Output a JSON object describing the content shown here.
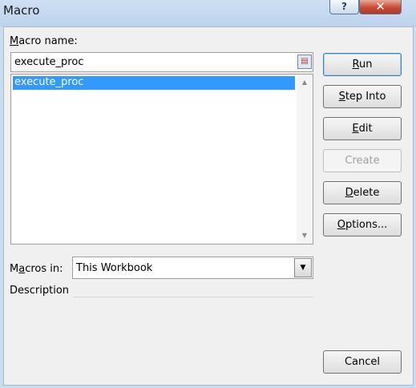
{
  "window": {
    "title": "Macro",
    "help_label": "?",
    "close_label": "✕"
  },
  "macro_name": {
    "label_prefix": "M",
    "label_rest": "acro name:",
    "value": "execute_proc"
  },
  "macro_list": {
    "items": [
      "execute_proc"
    ],
    "selected_index": 0
  },
  "buttons": {
    "run": {
      "u": "R",
      "rest": "un"
    },
    "step_into": {
      "u": "S",
      "rest": "tep Into"
    },
    "edit": {
      "u": "E",
      "rest": "dit"
    },
    "create": {
      "label": "Create"
    },
    "delete": {
      "u": "D",
      "rest": "elete"
    },
    "options": {
      "u": "O",
      "rest": "ptions..."
    },
    "cancel": {
      "label": "Cancel"
    }
  },
  "macros_in": {
    "label_a": "M",
    "label_u": "a",
    "label_b": "cros in:",
    "value": "This Workbook"
  },
  "description": {
    "label": "Description"
  },
  "icons": {
    "picker": "macro-picker-icon",
    "dropdown": "chevron-down-icon",
    "scroll_up": "scroll-up-icon",
    "scroll_down": "scroll-down-icon"
  }
}
